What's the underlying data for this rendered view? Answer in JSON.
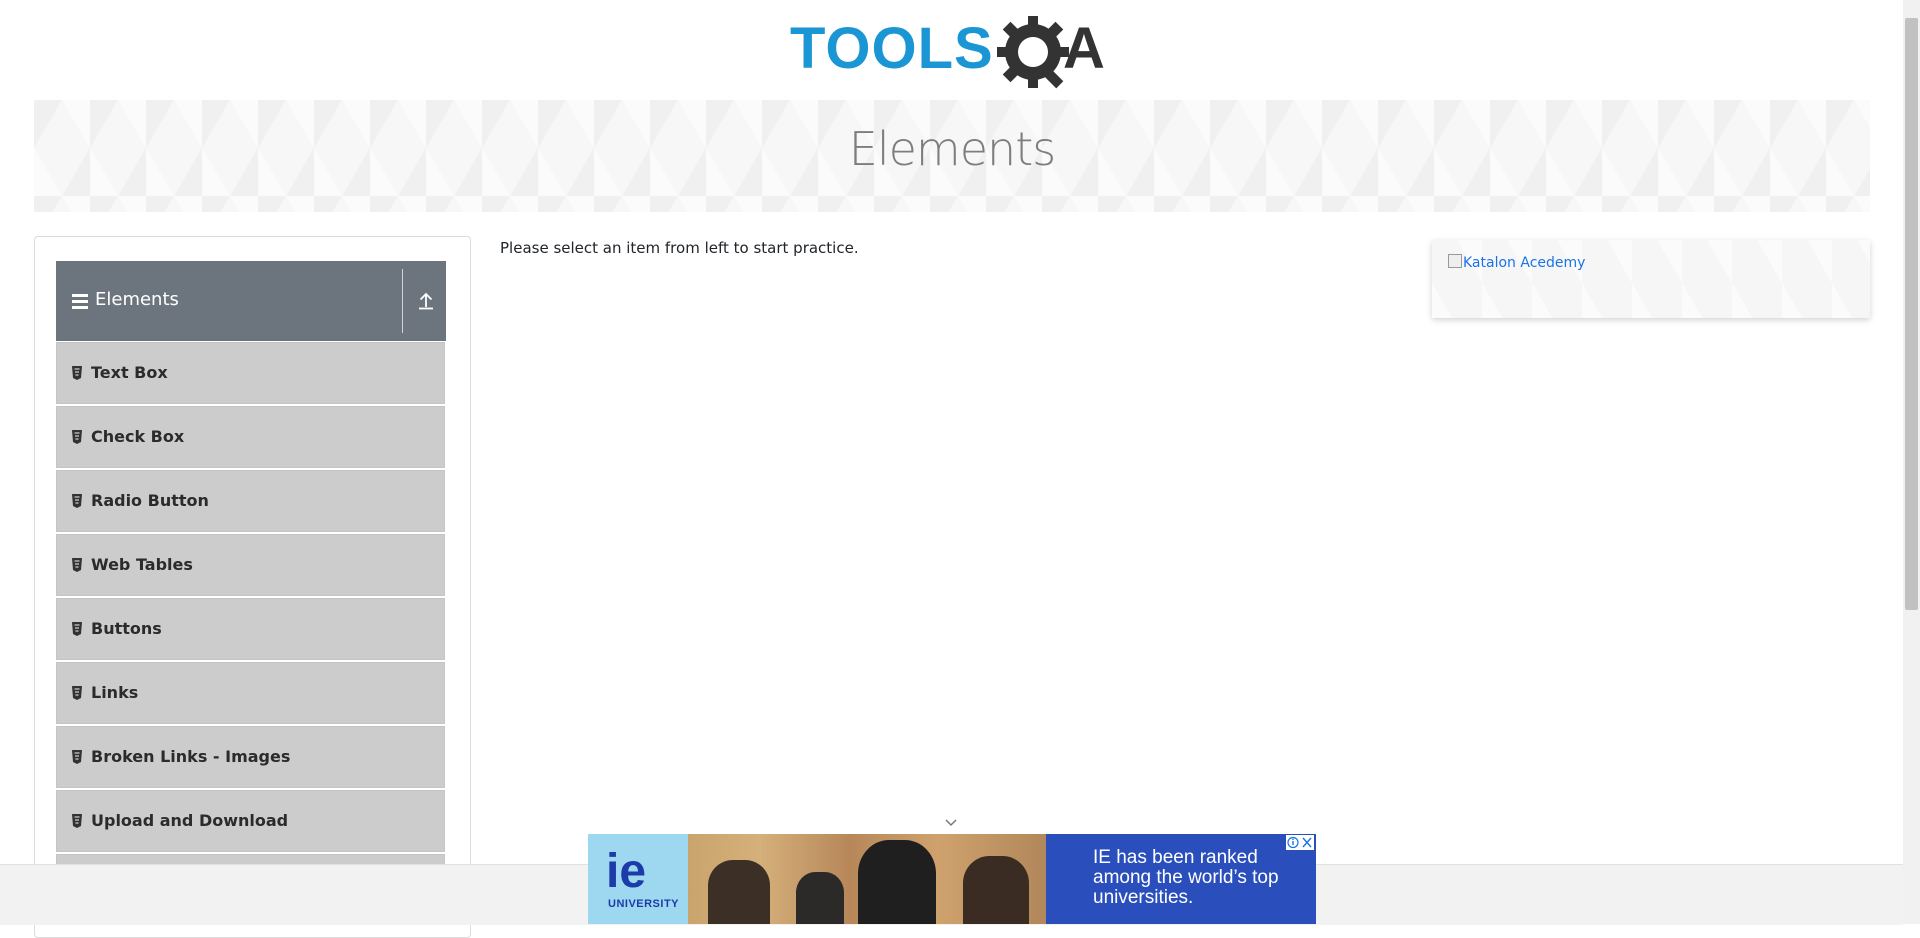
{
  "header": {
    "logo_text": "TOOLS",
    "logo_suffix": "A"
  },
  "banner": {
    "title": "Elements"
  },
  "sidebar": {
    "group_title": "Elements",
    "items": [
      {
        "label": "Text Box"
      },
      {
        "label": "Check Box"
      },
      {
        "label": "Radio Button"
      },
      {
        "label": "Web Tables"
      },
      {
        "label": "Buttons"
      },
      {
        "label": "Links"
      },
      {
        "label": "Broken Links - Images"
      },
      {
        "label": "Upload and Download"
      }
    ]
  },
  "main": {
    "message": "Please select an item from left to start practice."
  },
  "right_ad": {
    "alt_text": "Katalon Acedemy"
  },
  "bottom_ad": {
    "logo": "ie",
    "logo_sub": "UNIVERSITY",
    "headline": "IE has been ranked among the world’s top universities."
  },
  "colors": {
    "brand_blue": "#1a96d4",
    "header_gray": "#6c757d",
    "menu_gray": "#cccccc",
    "ad_blue": "#2a4fbd"
  }
}
